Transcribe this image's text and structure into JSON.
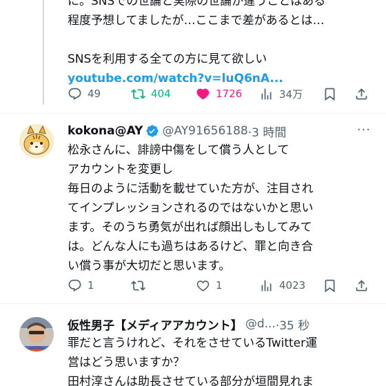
{
  "post1": {
    "lines": [
      "に。SNSでの世論と実際の世論が違うことはある",
      "程度予想してましたが…ここまで差があるとは…",
      "",
      "SNSを利用する全ての方に見て欲しい"
    ],
    "link": "youtube.com/watch?v=luQ6nA...",
    "actions": {
      "replies": "49",
      "reposts": "404",
      "likes": "1726",
      "views": "34万"
    },
    "colors": {
      "repost": "#00ba7c",
      "like": "#f91880"
    }
  },
  "post2": {
    "display_name": "kokona@AY",
    "handle": "@AY91656188",
    "time": "·3 時間",
    "lines": [
      "松永さんに、誹謗中傷をして償う人として",
      "アカウントを変更し",
      "毎日のように活動を載せていた方が、注目され",
      "てインプレッションされるのではないかと思い",
      "ます。そのうち勇気が出れば顔出しもしてみて",
      "は。どんな人にも過ちはあるけど、罪と向き合",
      "い償う事が大切だと思います。"
    ],
    "actions": {
      "replies": "1",
      "reposts": "",
      "likes": "1",
      "views": "4023"
    }
  },
  "post3": {
    "display_name": "仮性男子【メディアアカウント】",
    "handle": "@d...",
    "time": "·35 秒",
    "lines": [
      "罪だと言うけれど、それをさせているTwitter運",
      "営はどう思いますか？",
      "田村淳さんは助長させている部分が垣間見れま"
    ]
  },
  "icons": [
    "reply-icon",
    "repost-icon",
    "like-icon",
    "views-icon",
    "bookmark-icon",
    "share-icon",
    "verified-icon",
    "more-icon"
  ]
}
